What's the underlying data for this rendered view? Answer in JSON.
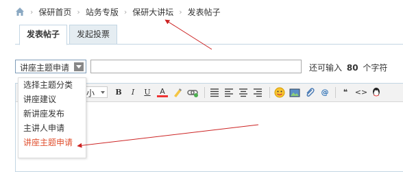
{
  "breadcrumb": {
    "items": [
      "保研首页",
      "站务专版",
      "保研大讲坛",
      "发表帖子"
    ]
  },
  "tabs": [
    {
      "label": "发表帖子",
      "active": true
    },
    {
      "label": "发起投票",
      "active": false
    }
  ],
  "title_row": {
    "category_selected": "讲座主题申请",
    "title_value": "",
    "counter_prefix": "还可输入",
    "counter_value": "80",
    "counter_suffix": "个字符"
  },
  "dropdown": {
    "options": [
      "选择主题分类",
      "讲座建议",
      "新讲座发布",
      "主讲人申请",
      "讲座主题申请"
    ],
    "selected_index": 4
  },
  "editor": {
    "fontsize_label": "小",
    "bold": "B",
    "italic": "I",
    "underline": "U",
    "color": "A",
    "at": "@",
    "quote": "❝",
    "code": "<>"
  },
  "colors": {
    "tab_border": "#c2d5e3",
    "tab_bg": "#e5edf2",
    "selected_option": "#e04f2e",
    "annotation_arrow": "#cc2222"
  }
}
